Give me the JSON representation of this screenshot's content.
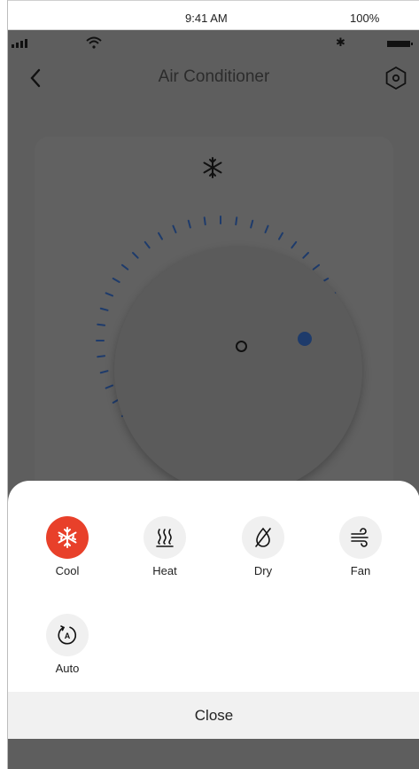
{
  "simulator": {
    "time": "9:41 AM",
    "battery": "100%"
  },
  "nav": {
    "title": "Air Conditioner"
  },
  "modes": [
    {
      "id": "cool",
      "label": "Cool",
      "active": true
    },
    {
      "id": "heat",
      "label": "Heat",
      "active": false
    },
    {
      "id": "dry",
      "label": "Dry",
      "active": false
    },
    {
      "id": "fan",
      "label": "Fan",
      "active": false
    },
    {
      "id": "auto",
      "label": "Auto",
      "active": false
    }
  ],
  "dial": {
    "level": 0.78
  },
  "sheet": {
    "close_label": "Close"
  },
  "colors": {
    "accent": "#e8402a",
    "tick_active": "#1e3b6b",
    "overlay": "#5e5e5e"
  }
}
